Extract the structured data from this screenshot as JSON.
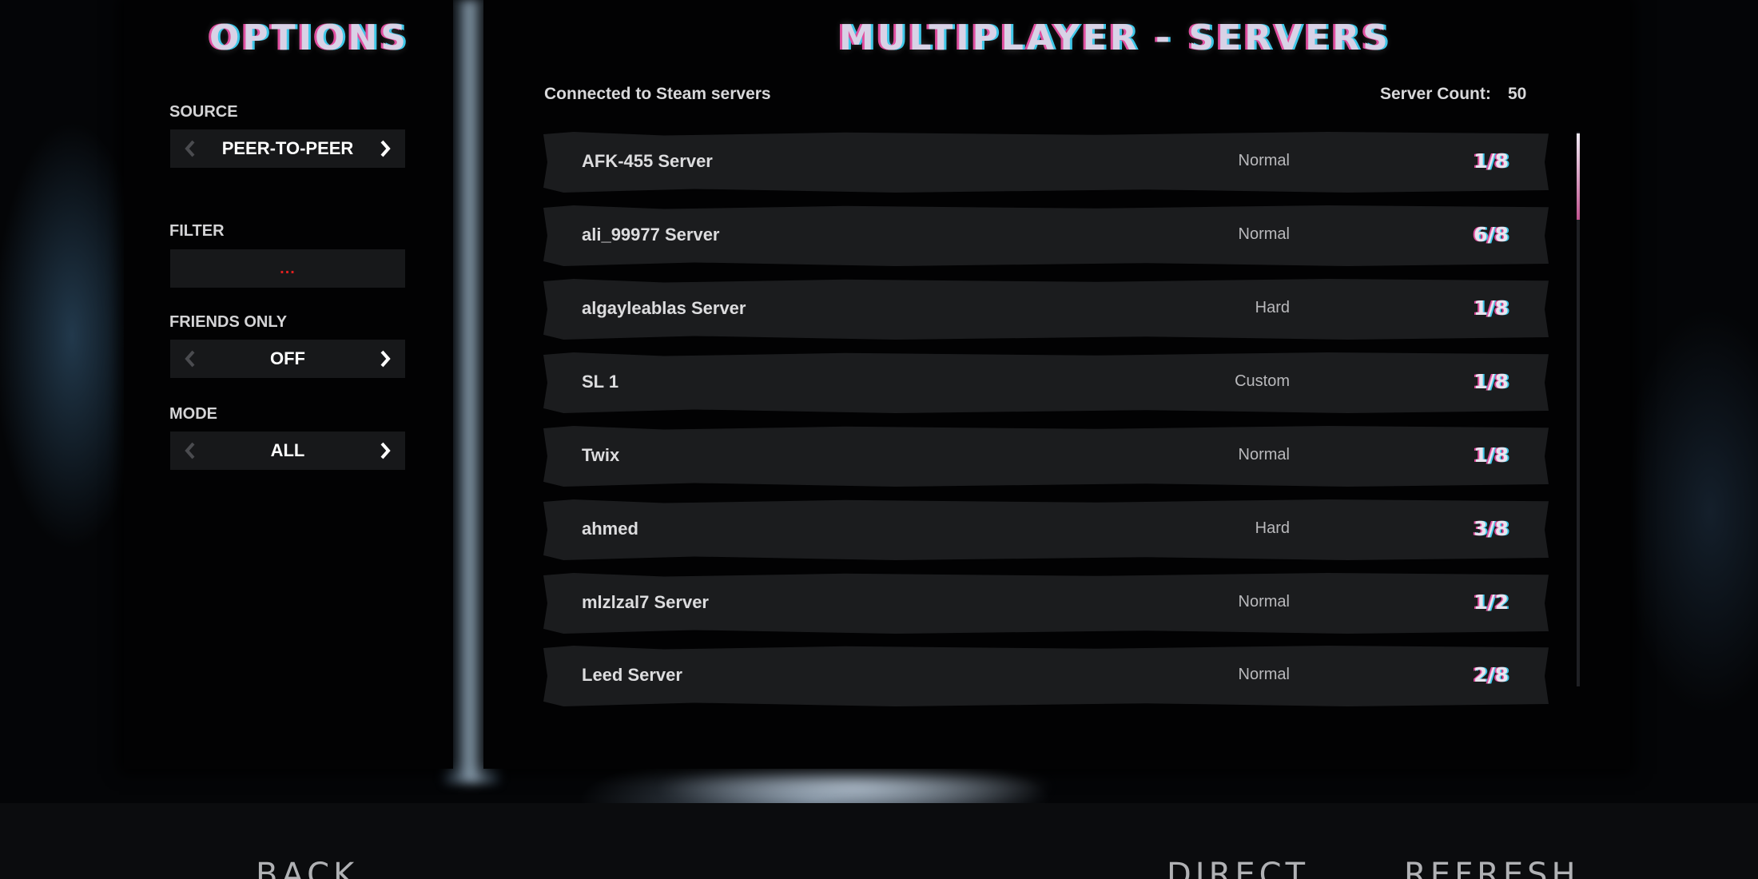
{
  "options": {
    "title": "OPTIONS",
    "source": {
      "label": "SOURCE",
      "value": "PEER-TO-PEER"
    },
    "filter": {
      "label": "FILTER",
      "value": "..."
    },
    "friends_only": {
      "label": "FRIENDS ONLY",
      "value": "OFF"
    },
    "mode": {
      "label": "MODE",
      "value": "ALL"
    }
  },
  "servers": {
    "title": "MULTIPLAYER - SERVERS",
    "connection_status": "Connected to Steam servers",
    "count_label": "Server Count:",
    "count_value": "50",
    "rows": [
      {
        "name": "AFK-455 Server",
        "mode": "Normal",
        "players": "1/8"
      },
      {
        "name": "ali_99977 Server",
        "mode": "Normal",
        "players": "6/8"
      },
      {
        "name": "algayleablas Server",
        "mode": "Hard",
        "players": "1/8"
      },
      {
        "name": "SL 1",
        "mode": "Custom",
        "players": "1/8"
      },
      {
        "name": "Twix",
        "mode": "Normal",
        "players": "1/8"
      },
      {
        "name": "ahmed",
        "mode": "Hard",
        "players": "3/8"
      },
      {
        "name": "mlzlzal7 Server",
        "mode": "Normal",
        "players": "1/2"
      },
      {
        "name": "Leed Server",
        "mode": "Normal",
        "players": "2/8"
      }
    ]
  },
  "buttons": {
    "back": "BACK",
    "direct": "DIRECT",
    "refresh": "REFRESH"
  },
  "colors": {
    "accent_pink": "#e04fa0",
    "accent_cyan": "#3ec7e8",
    "filter_text": "#e02020"
  },
  "icons": {
    "prev": "chevron-left-icon",
    "next": "chevron-right-icon"
  }
}
